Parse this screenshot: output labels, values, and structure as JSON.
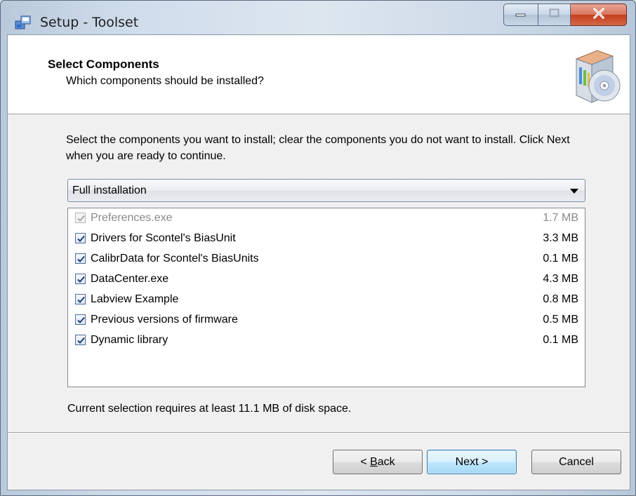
{
  "window": {
    "title": "Setup - Toolset",
    "minimize_icon": "minimize-icon",
    "maximize_icon": "maximize-icon",
    "close_icon": "close-icon"
  },
  "header": {
    "title": "Select Components",
    "subtitle": "Which components should be installed?",
    "icon": "install-disc-icon"
  },
  "description": "Select the components you want to install; clear the components you do not want to install. Click Next when you are ready to continue.",
  "install_type": {
    "selected": "Full installation"
  },
  "components": [
    {
      "name": "Preferences.exe",
      "size": "1.7 MB",
      "checked": true,
      "disabled": true
    },
    {
      "name": "Drivers for Scontel's BiasUnit",
      "size": "3.3 MB",
      "checked": true,
      "disabled": false
    },
    {
      "name": "CalibrData for Scontel's BiasUnits",
      "size": "0.1 MB",
      "checked": true,
      "disabled": false
    },
    {
      "name": "DataCenter.exe",
      "size": "4.3 MB",
      "checked": true,
      "disabled": false
    },
    {
      "name": "Labview Example",
      "size": "0.8 MB",
      "checked": true,
      "disabled": false
    },
    {
      "name": "Previous versions of firmware",
      "size": "0.5 MB",
      "checked": true,
      "disabled": false
    },
    {
      "name": "Dynamic library",
      "size": "0.1 MB",
      "checked": true,
      "disabled": false
    }
  ],
  "disk_space_text": "Current selection requires at least 11.1 MB of disk space.",
  "buttons": {
    "back_prefix": "< ",
    "back_mnemonic": "B",
    "back_rest": "ack",
    "next": "Next >",
    "cancel": "Cancel"
  },
  "colors": {
    "accent": "#3c7fb1",
    "close_button": "#c43c1c"
  }
}
